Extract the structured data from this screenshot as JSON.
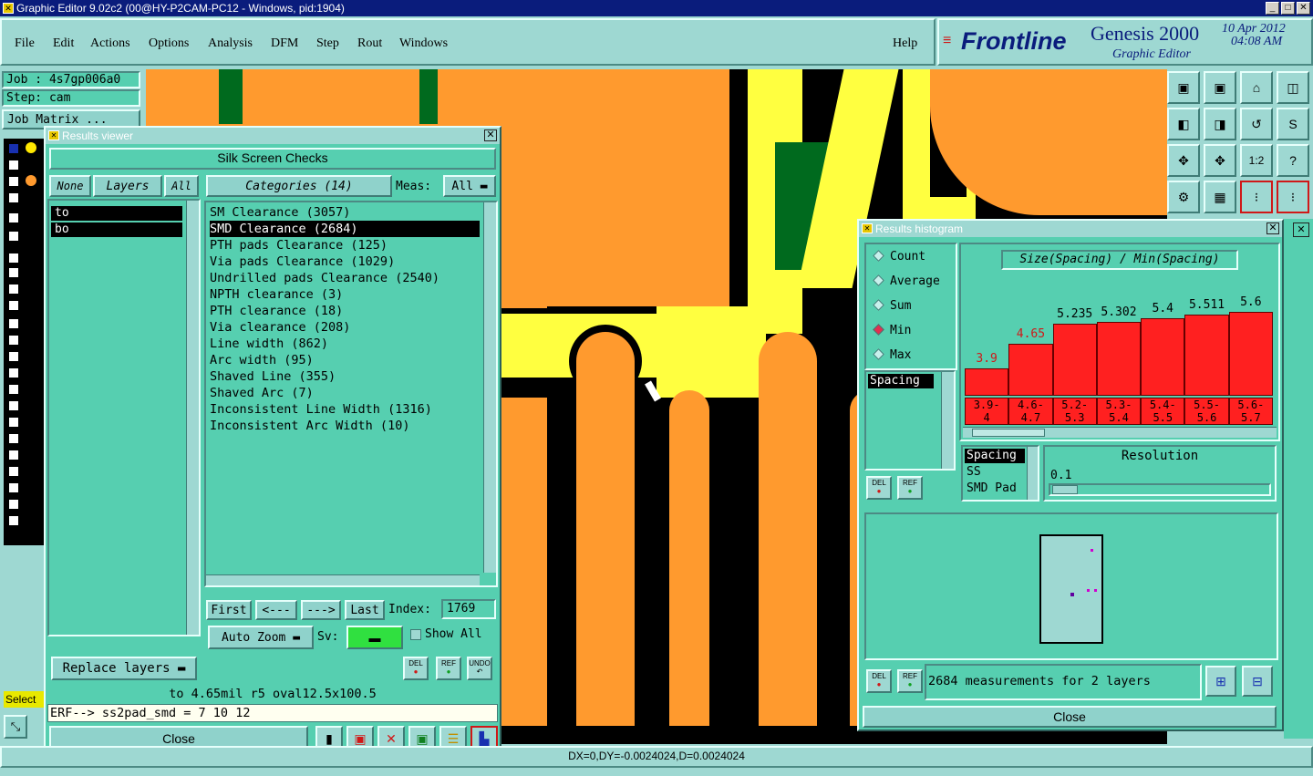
{
  "window": {
    "title": "Graphic Editor 9.02c2 (00@HY-P2CAM-PC12 - Windows, pid:1904)"
  },
  "menu": {
    "items": [
      "File",
      "Edit",
      "Actions",
      "Options",
      "Analysis",
      "DFM",
      "Step",
      "Rout",
      "Windows"
    ],
    "help": "Help"
  },
  "brand": {
    "logo": "Frontline",
    "product": "Genesis 2000",
    "subtitle": "Graphic Editor",
    "date": "10 Apr 2012",
    "time": "04:08 AM"
  },
  "job": {
    "job_label": "Job : 4s7gp006a0",
    "step_label": "Step: cam",
    "matrix_button": "Job Matrix ..."
  },
  "left": {
    "select_label": "Select"
  },
  "results_viewer": {
    "title": "Results viewer",
    "header": "Silk Screen Checks",
    "none": "None",
    "layers": "Layers",
    "all": "All",
    "categories_button": "Categories (14)",
    "meas_label": "Meas:",
    "meas_value": "All",
    "layer_items": [
      "to",
      "bo"
    ],
    "categories": [
      "SM Clearance (3057)",
      "SMD Clearance (2684)",
      "PTH pads Clearance (125)",
      "Via pads Clearance (1029)",
      "Undrilled pads Clearance (2540)",
      "NPTH clearance (3)",
      "PTH clearance (18)",
      "Via clearance (208)",
      "Line width (862)",
      "Arc width (95)",
      "Shaved Line (355)",
      "Shaved Arc (7)",
      "Inconsistent Line Width (1316)",
      "Inconsistent Arc Width (10)"
    ],
    "first": "First",
    "prev": "<---",
    "next": "--->",
    "last": "Last",
    "index_label": "Index:",
    "index_value": "1769",
    "auto_zoom": "Auto Zoom",
    "sv_label": "Sv:",
    "show_all": "Show All",
    "replace_layers": "Replace layers",
    "del": "DEL",
    "ref": "REF",
    "undo": "UNDO",
    "info": "to 4.65mil  r5  oval12.5x100.5",
    "erf": "ERF--> ss2pad_smd = 7 10 12",
    "close": "Close"
  },
  "histogram": {
    "title": "Results histogram",
    "chart_title": "Size(Spacing) / Min(Spacing)",
    "modes": [
      "Count",
      "Average",
      "Sum",
      "Min",
      "Max"
    ],
    "selected_mode": "Min",
    "list_item": "Spacing",
    "attrs": [
      "Spacing",
      "SS",
      "SMD Pad"
    ],
    "resolution_label": "Resolution",
    "resolution_value": "0.1",
    "del": "DEL",
    "ref": "REF",
    "status": "2684 measurements for 2 layers",
    "close": "Close",
    "bar_color": "#ff2020"
  },
  "chart_data": {
    "type": "bar",
    "title": "Size(Spacing) / Min(Spacing)",
    "categories": [
      "3.9-4",
      "4.6-4.7",
      "5.2-5.3",
      "5.3-5.4",
      "5.4-5.5",
      "5.5-5.6",
      "5.6-5.7"
    ],
    "values": [
      3.9,
      4.65,
      5.235,
      5.302,
      5.4,
      5.511,
      5.6
    ],
    "value_labels": [
      "3.9",
      "4.65",
      "5.235",
      "5.302",
      "5.4",
      "5.511",
      "5.6"
    ],
    "range_labels": [
      [
        "3.9-",
        "4"
      ],
      [
        "4.6-",
        "4.7"
      ],
      [
        "5.2-",
        "5.3"
      ],
      [
        "5.3-",
        "5.4"
      ],
      [
        "5.4-",
        "5.5"
      ],
      [
        "5.5-",
        "5.6"
      ],
      [
        "5.6-",
        "5.7"
      ]
    ],
    "xlabel": "",
    "ylabel": ""
  },
  "statusbar": {
    "coords": "DX=0,DY=-0.0024024,D=0.0024024"
  },
  "colors": {
    "copper": "#ff9a2e",
    "silk": "#ffff40",
    "mask": "#006a1e",
    "panel": "#56cfb0",
    "bg": "#9ed8d2"
  }
}
